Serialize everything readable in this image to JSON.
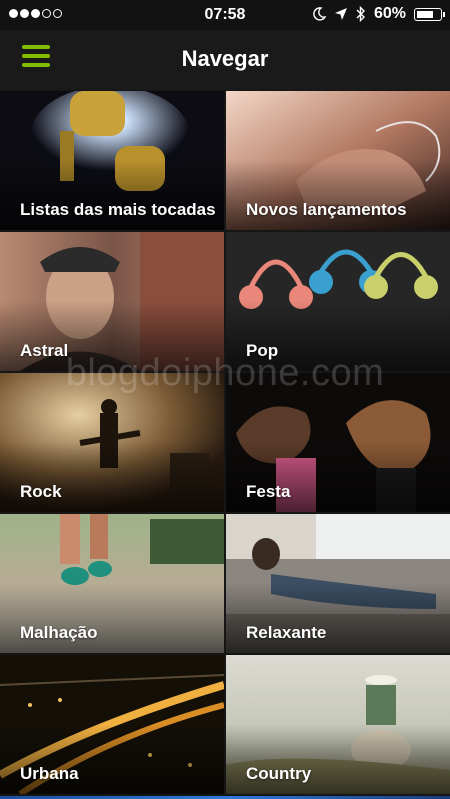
{
  "status_bar": {
    "signal_dots_full": 3,
    "signal_dots_total": 5,
    "time": "07:58",
    "battery_percent": "60%",
    "battery_level": 0.6
  },
  "navbar": {
    "title": "Navegar",
    "menu_icon": "hamburger-menu-icon",
    "accent_color": "#84bd00"
  },
  "tiles": [
    {
      "label": "Listas das mais tocadas"
    },
    {
      "label": "Novos lançamentos"
    },
    {
      "label": "Astral"
    },
    {
      "label": "Pop"
    },
    {
      "label": "Rock"
    },
    {
      "label": "Festa"
    },
    {
      "label": "Malhação"
    },
    {
      "label": "Relaxante"
    },
    {
      "label": "Urbana"
    },
    {
      "label": "Country"
    }
  ],
  "watermark": "blogdoiphone.com"
}
